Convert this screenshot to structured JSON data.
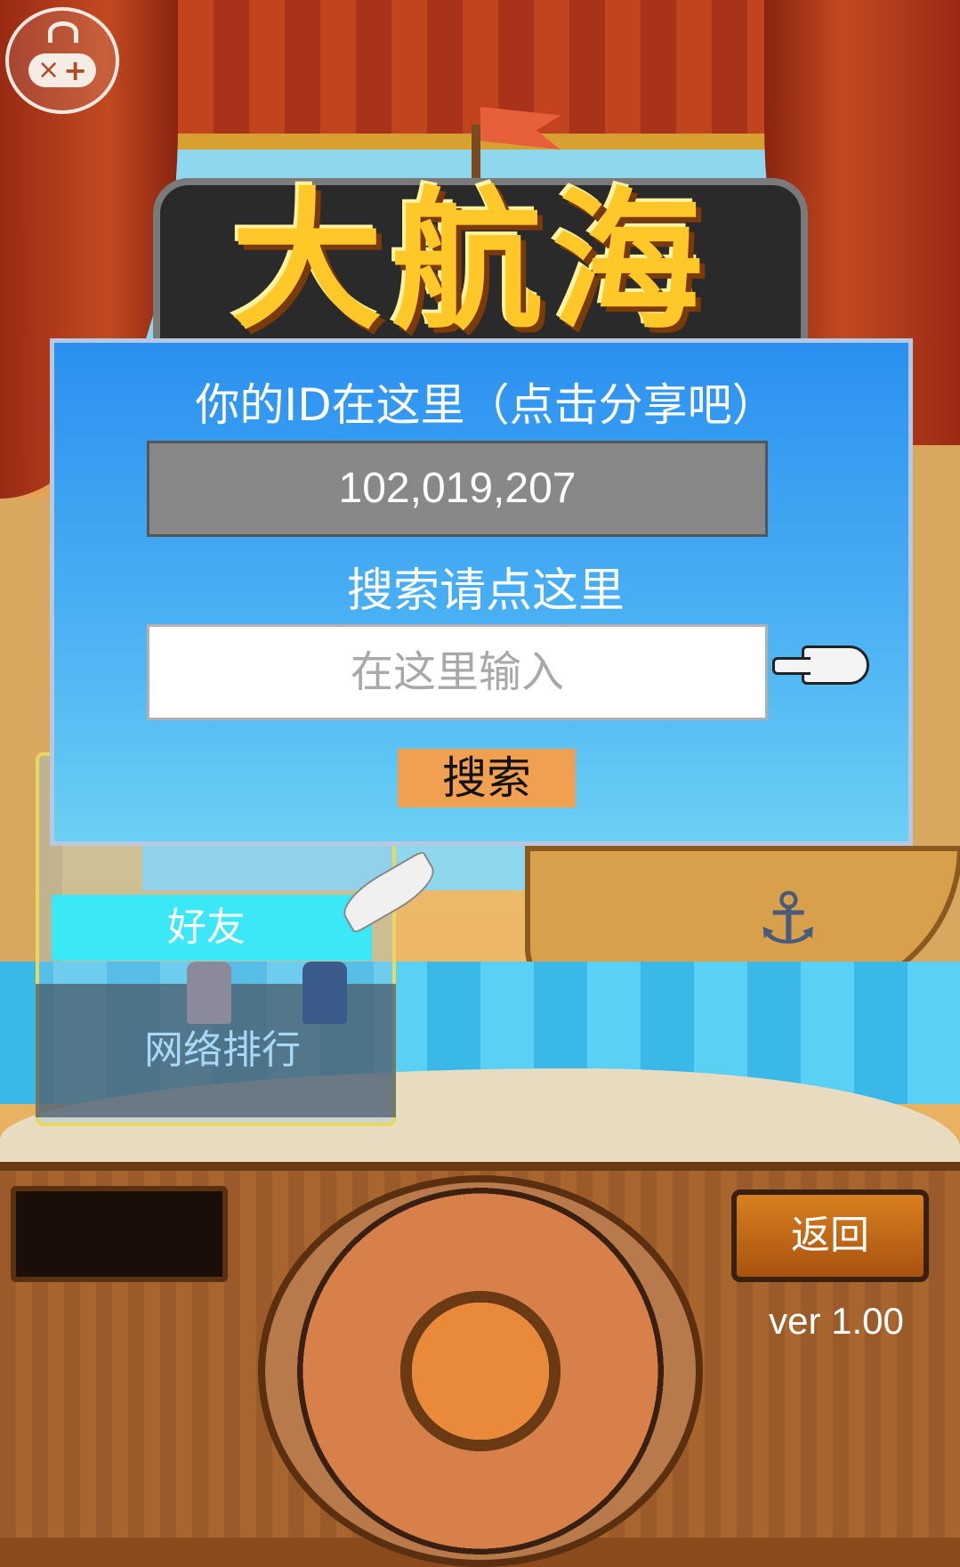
{
  "title_logo": "大航海",
  "dialog": {
    "id_label": "你的ID在这里（点击分享吧）",
    "id_value": "102,019,207",
    "search_label": "搜索请点这里",
    "search_placeholder": "在这里输入",
    "search_button": "搜索"
  },
  "menu": {
    "friends": "好友",
    "ranking": "网络排行"
  },
  "footer": {
    "back_button": "返回",
    "version": "ver 1.00"
  },
  "icons": {
    "gamepad": "gamepad-icon",
    "pointer": "pointing-hand-icon",
    "feather": "quill-cursor-icon",
    "anchor": "anchor-icon"
  },
  "colors": {
    "dialog_top": "#2a90f0",
    "dialog_bottom": "#6ad0f4",
    "search_button": "#f0a050",
    "friends_highlight": "#3ae8f8",
    "title_yellow": "#ffc828"
  }
}
